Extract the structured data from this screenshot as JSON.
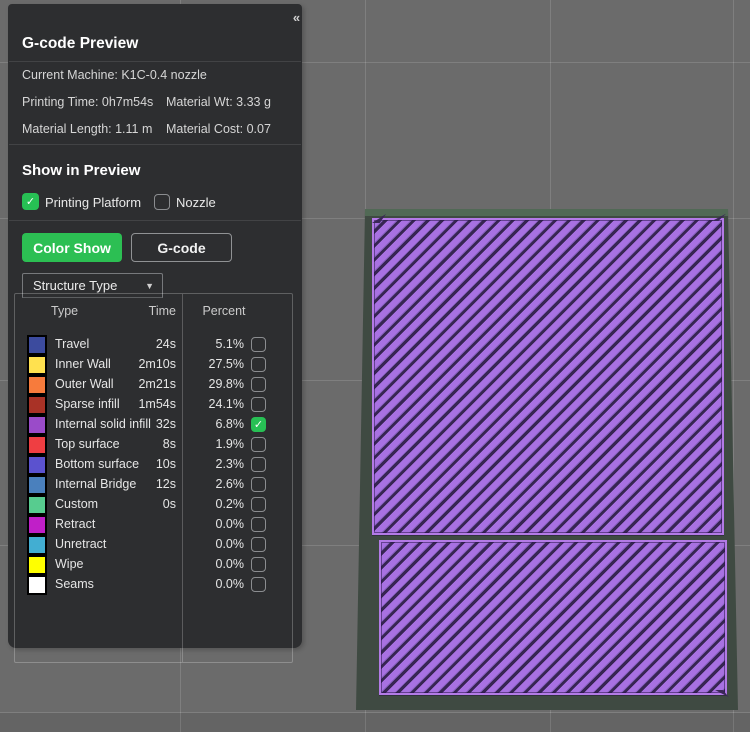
{
  "viewport": {
    "background_color": "#6b6b6b",
    "platform_color": "#3f4a42",
    "object_fill_color": "#a871e2",
    "object_hatch_color": "#372553"
  },
  "panel": {
    "collapse_icon": "«",
    "title": "G-code Preview",
    "info": {
      "current_machine": "Current Machine: K1C-0.4 nozzle",
      "printing_time": "Printing Time: 0h7m54s",
      "material_wt": "Material Wt: 3.33 g",
      "material_length": "Material Length: 1.11 m",
      "material_cost": "Material Cost: 0.07"
    },
    "show_in_preview": {
      "heading": "Show in Preview",
      "printing_platform_label": "Printing Platform",
      "printing_platform_checked": true,
      "nozzle_label": "Nozzle",
      "nozzle_checked": false
    },
    "buttons": {
      "color_show_label": "Color Show",
      "gcode_label": "G-code",
      "accent_color": "#2cbf53"
    },
    "structure_dropdown": {
      "label": "Structure Type",
      "caret": "▼"
    },
    "table": {
      "headers": {
        "type": "Type",
        "time": "Time",
        "percent": "Percent"
      },
      "check_glyph": "✓",
      "checked_color": "#27c054",
      "rows": [
        {
          "color": "#3c4b9e",
          "type": "Travel",
          "time": "24s",
          "percent": "5.1%",
          "checked": false
        },
        {
          "color": "#ffe14f",
          "type": "Inner Wall",
          "time": "2m10s",
          "percent": "27.5%",
          "checked": false
        },
        {
          "color": "#f77b3c",
          "type": "Outer Wall",
          "time": "2m21s",
          "percent": "29.8%",
          "checked": false
        },
        {
          "color": "#a93226",
          "type": "Sparse infill",
          "time": "1m54s",
          "percent": "24.1%",
          "checked": false
        },
        {
          "color": "#9a4bc9",
          "type": "Internal solid infill",
          "time": "32s",
          "percent": "6.8%",
          "checked": true
        },
        {
          "color": "#ef3e42",
          "type": "Top surface",
          "time": "8s",
          "percent": "1.9%",
          "checked": false
        },
        {
          "color": "#5b52cf",
          "type": "Bottom surface",
          "time": "10s",
          "percent": "2.3%",
          "checked": false
        },
        {
          "color": "#4a80bd",
          "type": "Internal Bridge",
          "time": "12s",
          "percent": "2.6%",
          "checked": false
        },
        {
          "color": "#57cc8f",
          "type": "Custom",
          "time": "0s",
          "percent": "0.2%",
          "checked": false
        },
        {
          "color": "#c01fc8",
          "type": "Retract",
          "time": "",
          "percent": "0.0%",
          "checked": false
        },
        {
          "color": "#42aed2",
          "type": "Unretract",
          "time": "",
          "percent": "0.0%",
          "checked": false
        },
        {
          "color": "#ffff00",
          "type": "Wipe",
          "time": "",
          "percent": "0.0%",
          "checked": false
        },
        {
          "color": "#ffffff",
          "type": "Seams",
          "time": "",
          "percent": "0.0%",
          "checked": false
        }
      ]
    }
  }
}
